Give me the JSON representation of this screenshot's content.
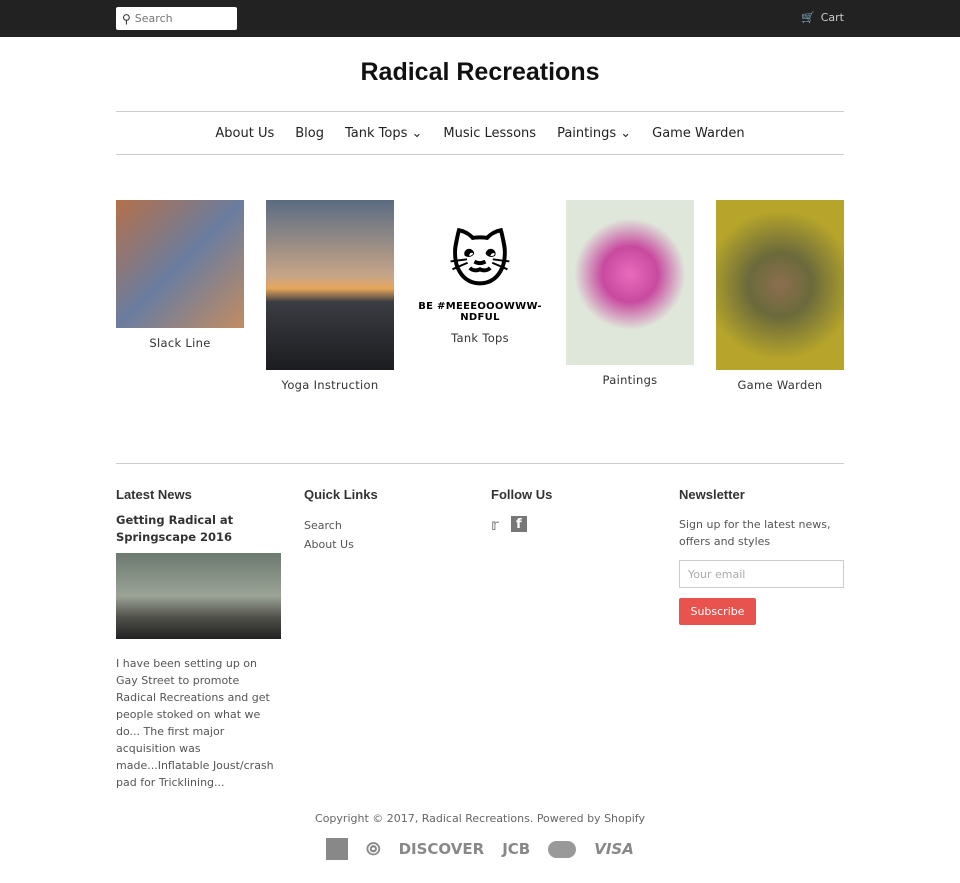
{
  "header": {
    "search_placeholder": "Search",
    "cart_label": "Cart",
    "site_title": "Radical Recreations"
  },
  "nav": [
    {
      "label": "About Us"
    },
    {
      "label": "Blog"
    },
    {
      "label": "Tank Tops ⌄"
    },
    {
      "label": "Music Lessons"
    },
    {
      "label": "Paintings ⌄"
    },
    {
      "label": "Game Warden"
    }
  ],
  "collections": [
    {
      "label": "Slack Line"
    },
    {
      "label": "Yoga Instruction"
    },
    {
      "label": "Tank Tops",
      "image_text": "BE #MEEEOOOWWW-NDFUL"
    },
    {
      "label": "Paintings"
    },
    {
      "label": "Game Warden"
    }
  ],
  "footer": {
    "latest_news": {
      "heading": "Latest News",
      "article_title": "Getting Radical at Springscape 2016",
      "excerpt": "I have been setting up on Gay Street to promote Radical Recreations and get people stoked on what we do... The first major acquisition was made...Inflatable Joust/crash pad for Tricklining..."
    },
    "quick_links": {
      "heading": "Quick Links",
      "links": [
        "Search",
        "About Us"
      ]
    },
    "follow": {
      "heading": "Follow Us",
      "icons": [
        "twitter-icon",
        "facebook-icon"
      ]
    },
    "newsletter": {
      "heading": "Newsletter",
      "text": "Sign up for the latest news, offers and styles",
      "placeholder": "Your email",
      "button": "Subscribe",
      "button_color": "#e9534d"
    },
    "copyright": "Copyright © 2017, Radical Recreations. Powered by Shopify",
    "payments": [
      "American Express",
      "Diners",
      "DISCOVER",
      "JCB",
      "Master",
      "VISA"
    ]
  }
}
